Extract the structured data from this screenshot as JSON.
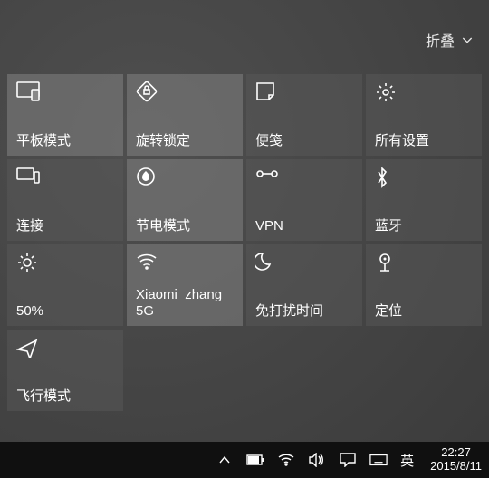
{
  "collapse_label": "折叠",
  "tiles": [
    {
      "id": "tablet-mode",
      "label": "平板模式",
      "dim": false
    },
    {
      "id": "rotation-lock",
      "label": "旋转锁定",
      "dim": false
    },
    {
      "id": "note",
      "label": "便笺",
      "dim": true
    },
    {
      "id": "all-settings",
      "label": "所有设置",
      "dim": true
    },
    {
      "id": "connect",
      "label": "连接",
      "dim": true
    },
    {
      "id": "battery-saver",
      "label": "节电模式",
      "dim": false
    },
    {
      "id": "vpn",
      "label": "VPN",
      "dim": true
    },
    {
      "id": "bluetooth",
      "label": "蓝牙",
      "dim": true
    },
    {
      "id": "brightness",
      "label": "50%",
      "dim": true
    },
    {
      "id": "wifi",
      "label": "Xiaomi_zhang_5G",
      "dim": false
    },
    {
      "id": "quiet-hours",
      "label": "免打扰时间",
      "dim": true
    },
    {
      "id": "location",
      "label": "定位",
      "dim": true
    },
    {
      "id": "airplane-mode",
      "label": "飞行模式",
      "dim": true
    }
  ],
  "taskbar": {
    "ime": "英",
    "time": "22:27",
    "date": "2015/8/11"
  }
}
